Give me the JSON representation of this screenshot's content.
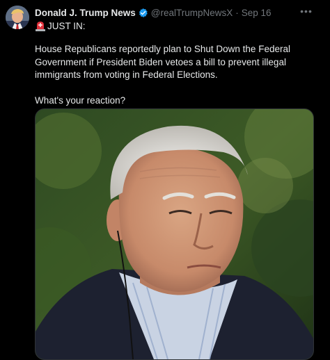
{
  "tweet": {
    "display_name": "Donald J. Trump News",
    "handle": "@realTrumpNewsX",
    "separator": "·",
    "timestamp": "Sep 16",
    "more_label": "•••",
    "headline": "JUST IN:",
    "paragraph1": "House Republicans reportedly plan to Shut Down the Federal Government if President Biden vetoes a bill to prevent illegal immigrants from voting in Federal Elections.",
    "paragraph2": "What's your reaction?"
  },
  "icons": {
    "verified": "verified-badge-icon",
    "siren": "siren-emoji-icon",
    "more": "more-options-icon"
  },
  "colors": {
    "background": "#000000",
    "text": "#e7e9ea",
    "secondary": "#71767b",
    "verified": "#1d9bf0",
    "siren": "#e0313b"
  }
}
